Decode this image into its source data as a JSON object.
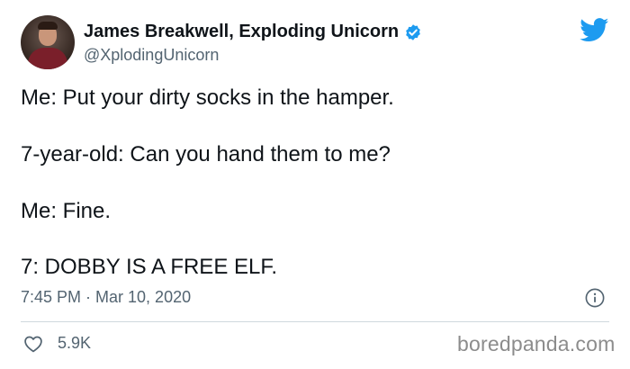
{
  "author": {
    "display_name": "James Breakwell, Exploding Unicorn",
    "handle": "@XplodingUnicorn",
    "verified": true
  },
  "tweet": {
    "lines": [
      "Me: Put your dirty socks in the hamper.",
      "7-year-old: Can you hand them to me?",
      "Me: Fine.",
      "7: DOBBY IS A FREE ELF."
    ],
    "timestamp": "7:45 PM · Mar 10, 2020",
    "likes": "5.9K"
  },
  "watermark": "boredpanda.com",
  "icons": {
    "brand": "twitter-logo-icon",
    "verified": "verified-badge-icon",
    "info": "info-icon",
    "like": "heart-icon"
  },
  "colors": {
    "twitter_blue": "#1d9bf0",
    "text_primary": "#0f1419",
    "text_secondary": "#536471",
    "divider": "#cfd9de"
  }
}
